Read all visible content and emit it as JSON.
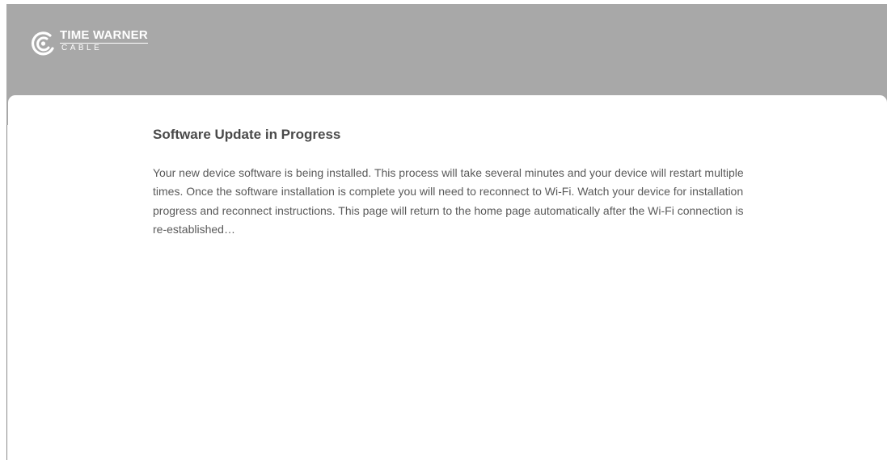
{
  "brand": {
    "line1": "TIME WARNER",
    "line2": "CABLE",
    "logo_icon": "eye-ear-logo-icon",
    "header_color": "#a8a8a8"
  },
  "main": {
    "title": "Software Update in Progress",
    "message": "Your new device software is being installed. This process will take several minutes and your device will restart multiple times. Once the software installation is complete you will need to reconnect to Wi-Fi. Watch your device for installation progress and reconnect instructions. This page will return to the home page automatically after the Wi-Fi connection is re-established…"
  }
}
